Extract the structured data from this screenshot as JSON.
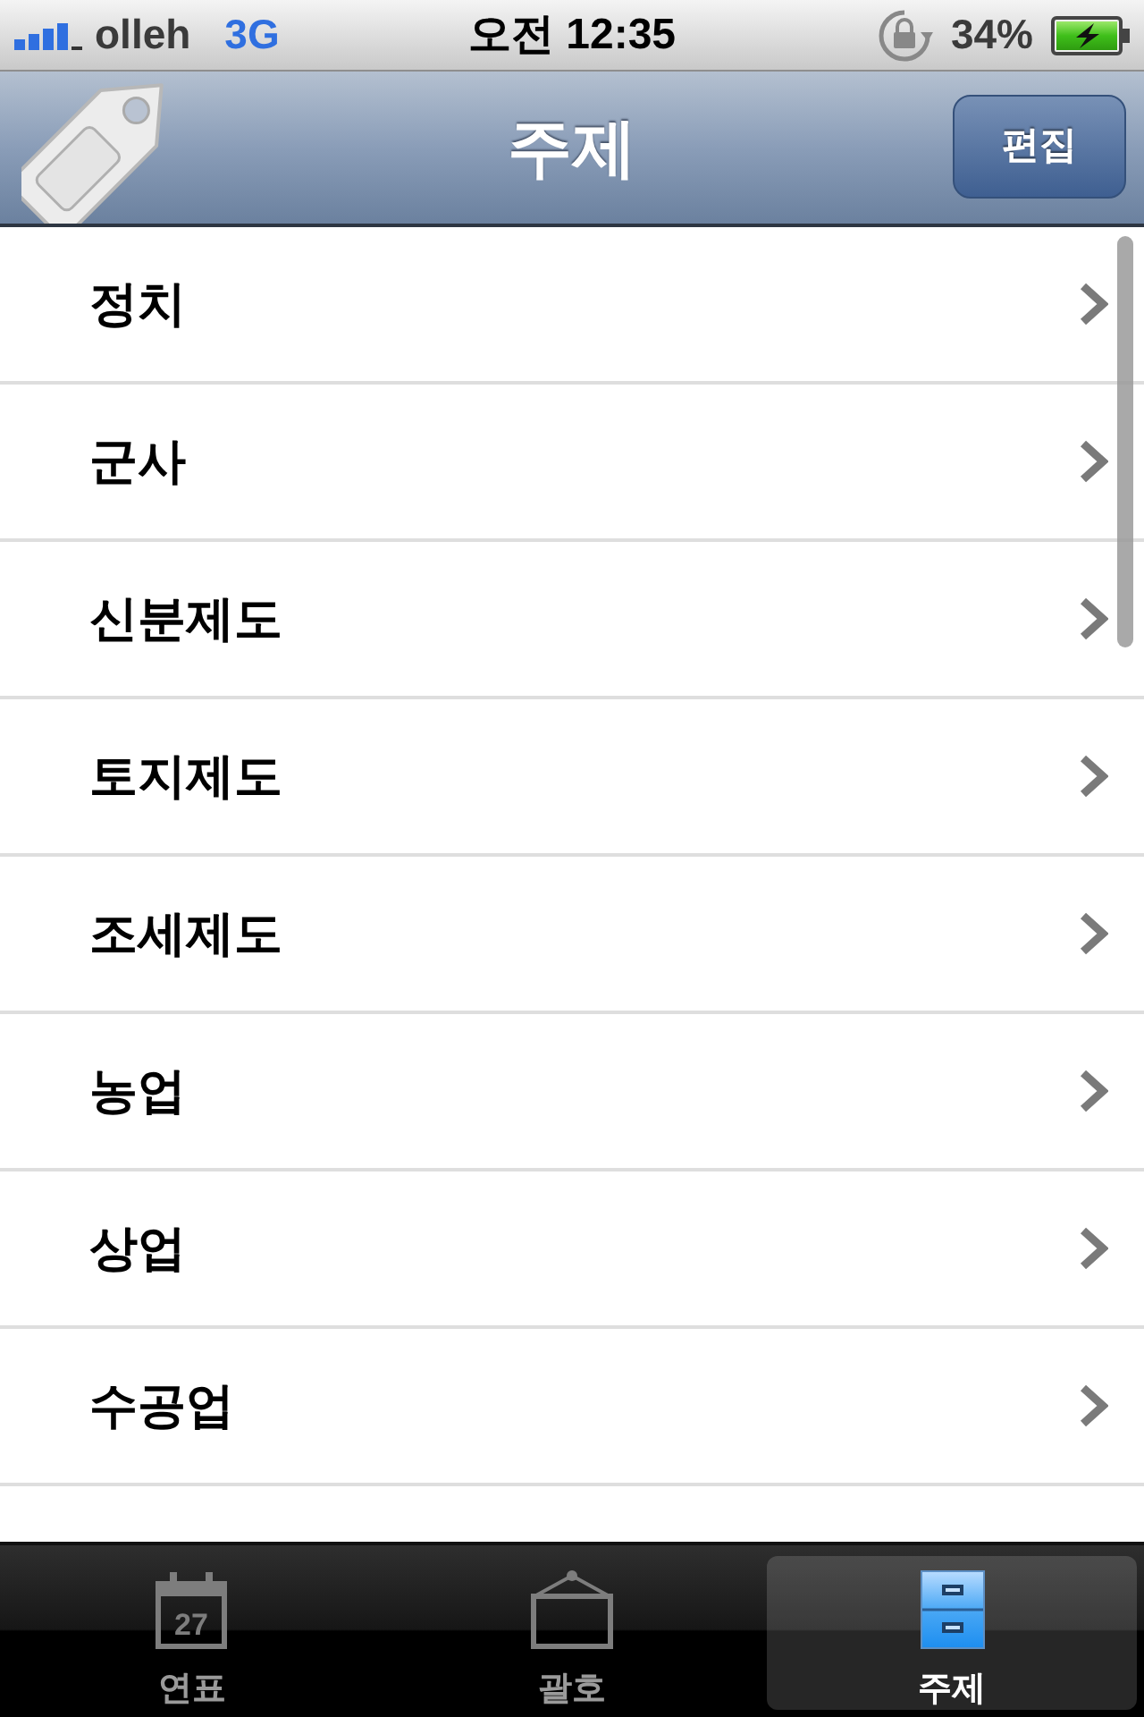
{
  "status_bar": {
    "carrier": "olleh",
    "network": "3G",
    "time": "오전 12:35",
    "battery_percent": "34%",
    "charging": true
  },
  "nav_bar": {
    "title": "주제",
    "edit_button": "편집"
  },
  "list": {
    "items": [
      {
        "label": "정치"
      },
      {
        "label": "군사"
      },
      {
        "label": "신분제도"
      },
      {
        "label": "토지제도"
      },
      {
        "label": "조세제도"
      },
      {
        "label": "농업"
      },
      {
        "label": "상업"
      },
      {
        "label": "수공업"
      }
    ]
  },
  "tab_bar": {
    "tabs": [
      {
        "label": "연표",
        "kind": "calendar",
        "icon_text": "27",
        "selected": false
      },
      {
        "label": "괄호",
        "kind": "frame",
        "selected": false
      },
      {
        "label": "주제",
        "kind": "cabinet",
        "selected": true
      }
    ]
  }
}
